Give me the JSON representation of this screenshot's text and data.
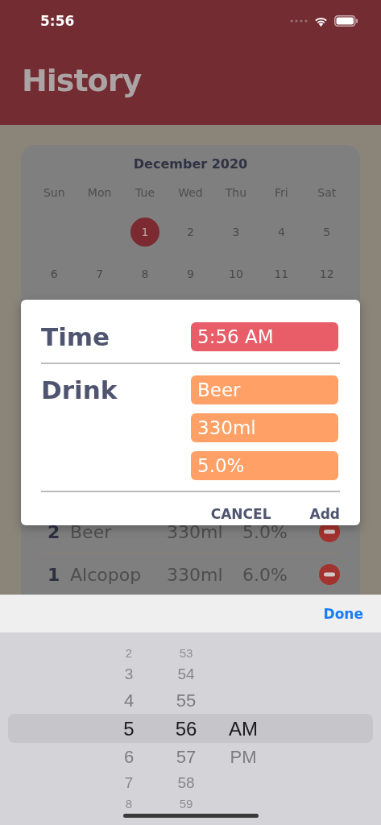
{
  "status_bar": {
    "time": "5:56"
  },
  "header": {
    "title": "History"
  },
  "calendar": {
    "month": "December 2020",
    "weekdays": [
      "Sun",
      "Mon",
      "Tue",
      "Wed",
      "Thu",
      "Fri",
      "Sat"
    ],
    "weeks": [
      [
        {
          "kind": "blank"
        },
        {
          "kind": "blank"
        },
        {
          "kind": "day",
          "day": "1",
          "selected": true
        },
        {
          "kind": "day",
          "day": "2",
          "selected": false
        },
        {
          "kind": "day",
          "day": "3",
          "selected": false
        },
        {
          "kind": "day",
          "day": "4",
          "selected": false
        },
        {
          "kind": "day",
          "day": "5",
          "selected": false
        }
      ],
      [
        {
          "kind": "day",
          "day": "6",
          "selected": false
        },
        {
          "kind": "day",
          "day": "7",
          "selected": false
        },
        {
          "kind": "day",
          "day": "8",
          "selected": false
        },
        {
          "kind": "day",
          "day": "9",
          "selected": false
        },
        {
          "kind": "day",
          "day": "10",
          "selected": false
        },
        {
          "kind": "day",
          "day": "11",
          "selected": false
        },
        {
          "kind": "day",
          "day": "12",
          "selected": false
        }
      ]
    ]
  },
  "entries": [
    {
      "number": "2",
      "drink": "Beer",
      "volume": "330ml",
      "abv": "5.0%"
    },
    {
      "number": "1",
      "drink": "Alcopop",
      "volume": "330ml",
      "abv": "6.0%"
    }
  ],
  "dialog": {
    "time_label": "Time",
    "time_value": "5:56 AM",
    "drink_label": "Drink",
    "drink_fields": [
      "Beer",
      "330ml",
      "5.0%"
    ],
    "buttons": [
      "CANCEL",
      "Add"
    ]
  },
  "keyboard_toolbar": {
    "done": "Done"
  },
  "picker": {
    "columns": [
      {
        "items": [
          {
            "text": "2",
            "selected": false
          },
          {
            "text": "3",
            "selected": false
          },
          {
            "text": "4",
            "selected": false
          },
          {
            "text": "5",
            "selected": true
          },
          {
            "text": "6",
            "selected": false
          },
          {
            "text": "7",
            "selected": false
          },
          {
            "text": "8",
            "selected": false
          }
        ]
      },
      {
        "items": [
          {
            "text": "53",
            "selected": false
          },
          {
            "text": "54",
            "selected": false
          },
          {
            "text": "55",
            "selected": false
          },
          {
            "text": "56",
            "selected": true
          },
          {
            "text": "57",
            "selected": false
          },
          {
            "text": "58",
            "selected": false
          },
          {
            "text": "59",
            "selected": false
          }
        ]
      },
      {
        "items": [
          {
            "text": "AM",
            "selected": true
          },
          {
            "text": "PM",
            "selected": false
          }
        ]
      }
    ]
  }
}
